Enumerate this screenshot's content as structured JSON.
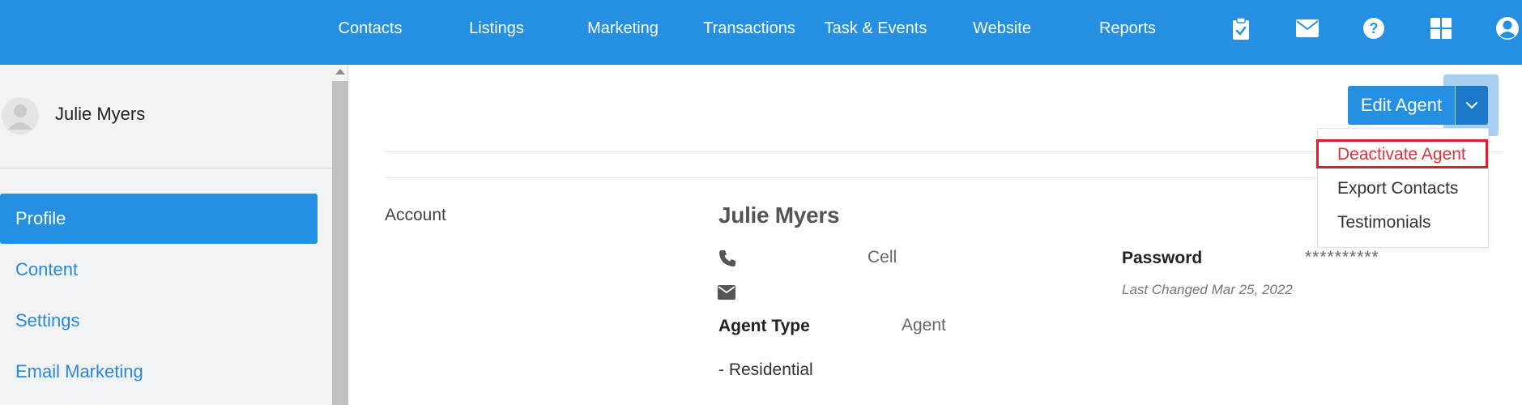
{
  "nav": {
    "items": [
      "Contacts",
      "Listings",
      "Marketing",
      "Transactions",
      "Task & Events",
      "Website",
      "Reports"
    ],
    "icons": [
      "clipboard-check-icon",
      "envelope-icon",
      "question-circle-icon",
      "grid-icon",
      "user-circle-icon"
    ],
    "color": "#2590e2"
  },
  "sidebar": {
    "user_name": "Julie Myers",
    "items": [
      {
        "label": "Profile",
        "active": true
      },
      {
        "label": "Content",
        "active": false
      },
      {
        "label": "Settings",
        "active": false
      },
      {
        "label": "Email Marketing",
        "active": false
      }
    ]
  },
  "actions": {
    "edit_agent": "Edit Agent",
    "dropdown": [
      "Deactivate Agent",
      "Export Contacts",
      "Testimonials"
    ]
  },
  "profile": {
    "section_label": "Account",
    "name": "Julie Myers",
    "phone_type": "Cell",
    "password_label": "Password",
    "password_value": "**********",
    "password_changed": "Last Changed Mar 25, 2022",
    "agent_type_label": "Agent Type",
    "agent_type_value": "Agent",
    "agent_subtype": "- Residential"
  },
  "colors": {
    "accent": "#2590e2",
    "accent_dark": "#1c78c9",
    "danger": "#d9343a",
    "highlight": "#e11d2b"
  }
}
